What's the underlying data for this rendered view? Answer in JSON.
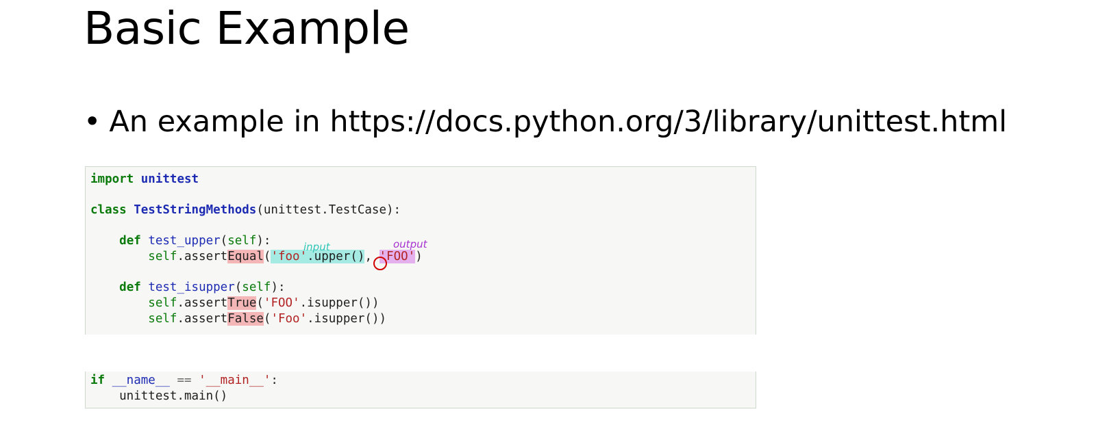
{
  "slide": {
    "title": "Basic Example",
    "bullet": "•",
    "bullet_text": "An example in https://docs.python.org/3/library/unittest.html"
  },
  "code": {
    "l1_kw": "import",
    "l1_mod": "unittest",
    "l3_kw": "class",
    "l3_name": "TestStringMethods",
    "l3_rest": "(unittest.TestCase):",
    "l5_indent": "    ",
    "l5_kw": "def",
    "l5_fn": "test_upper",
    "l5_p1": "(",
    "l5_self": "self",
    "l5_p2": "):",
    "l6_indent": "        ",
    "l6_self": "self",
    "l6_a": ".assert",
    "l6_equal": "Equal",
    "l6_b": "(",
    "l6_foo": "'foo'",
    "l6_upper": ".upper()",
    "l6_comma": ", ",
    "l6_FOO": "'FOO'",
    "l6_end": ")",
    "l8_indent": "    ",
    "l8_kw": "def",
    "l8_fn": "test_isupper",
    "l8_p1": "(",
    "l8_self": "self",
    "l8_p2": "):",
    "l9_indent": "        ",
    "l9_self": "self",
    "l9_a": ".assert",
    "l9_true": "True",
    "l9_b": "(",
    "l9_str": "'FOO'",
    "l9_end": ".isupper())",
    "l10_indent": "        ",
    "l10_self": "self",
    "l10_a": ".assert",
    "l10_false": "False",
    "l10_b": "(",
    "l10_str": "'Foo'",
    "l10_end": ".isupper())",
    "b1_kw": "if",
    "b1_name": " __name__",
    "b1_eq": " == ",
    "b1_str": "'__main__'",
    "b1_end": ":",
    "b2": "    unittest.main()"
  },
  "annotations": {
    "input": "input",
    "output": "output"
  },
  "colors": {
    "input_highlight": "#a6ebe3",
    "output_highlight": "#e4b1ee",
    "assert_highlight": "#f4b6b6",
    "circle": "#d10000"
  }
}
